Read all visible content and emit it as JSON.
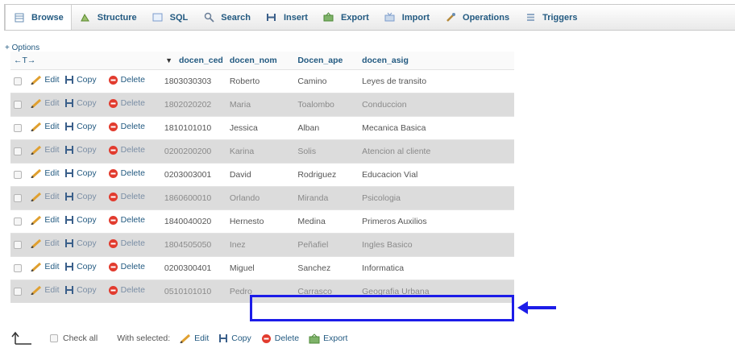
{
  "tabs": [
    {
      "label": "Browse",
      "icon": "browse-icon",
      "active": true
    },
    {
      "label": "Structure",
      "icon": "structure-icon"
    },
    {
      "label": "SQL",
      "icon": "sql-icon"
    },
    {
      "label": "Search",
      "icon": "search-icon"
    },
    {
      "label": "Insert",
      "icon": "insert-icon"
    },
    {
      "label": "Export",
      "icon": "export-icon"
    },
    {
      "label": "Import",
      "icon": "import-icon"
    },
    {
      "label": "Operations",
      "icon": "operations-icon"
    },
    {
      "label": "Triggers",
      "icon": "triggers-icon"
    }
  ],
  "options_link": "+ Options",
  "arrows_label": "←T→",
  "columns": [
    "docen_ced",
    "docen_nom",
    "Docen_ape",
    "docen_asig"
  ],
  "actions": {
    "edit": "Edit",
    "copy": "Copy",
    "delete": "Delete"
  },
  "rows": [
    {
      "ced": "1803030303",
      "nom": "Roberto",
      "ape": "Camino",
      "asig": "Leyes de transito"
    },
    {
      "ced": "1802020202",
      "nom": "Maria",
      "ape": "Toalombo",
      "asig": "Conduccion"
    },
    {
      "ced": "1810101010",
      "nom": "Jessica",
      "ape": "Alban",
      "asig": "Mecanica Basica"
    },
    {
      "ced": "0200200200",
      "nom": "Karina",
      "ape": "Solis",
      "asig": "Atencion al cliente"
    },
    {
      "ced": "0203003001",
      "nom": "David",
      "ape": "Rodriguez",
      "asig": "Educacion Vial"
    },
    {
      "ced": "1860600010",
      "nom": "Orlando",
      "ape": "Miranda",
      "asig": "Psicologia"
    },
    {
      "ced": "1840040020",
      "nom": "Hernesto",
      "ape": "Medina",
      "asig": "Primeros Auxilios"
    },
    {
      "ced": "1804505050",
      "nom": "Inez",
      "ape": "Peñafiel",
      "asig": "Ingles Basico"
    },
    {
      "ced": "0200300401",
      "nom": "Miguel",
      "ape": "Sanchez",
      "asig": "Informatica"
    },
    {
      "ced": "0510101010",
      "nom": "Pedro",
      "ape": "Carrasco",
      "asig": "Geografia Urbana"
    }
  ],
  "highlight_color": "#1c1ce8",
  "footer": {
    "check_all": "Check all",
    "with_selected": "With selected:",
    "edit": "Edit",
    "copy": "Copy",
    "delete": "Delete",
    "export": "Export"
  }
}
